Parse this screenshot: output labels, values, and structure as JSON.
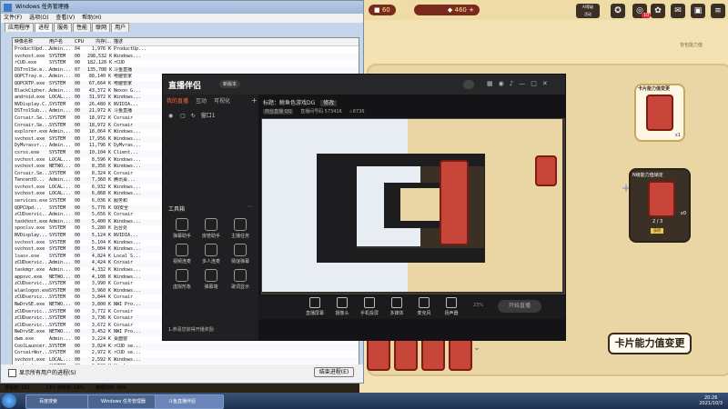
{
  "game": {
    "resources": [
      {
        "icon": "ticket-icon",
        "count": "60"
      },
      {
        "icon": "gem-icon",
        "count": "460"
      }
    ],
    "top_icons": [
      "gift-icon",
      "mail-icon",
      "settings-icon",
      "map-icon",
      "menu-icon"
    ],
    "top_icon_labels": {
      "g1": "A/等级",
      "g2": "活动"
    },
    "notification_count": "10",
    "panel_title": "卡片能力值变更",
    "card_label_top": "卡片能力值变更",
    "card_label_mid": "N级能力值锁定",
    "card_count_top": "x1",
    "card_count_mid": "x0",
    "card_pages": "2 / 3",
    "card_tag": "获得",
    "action_button": "卡片能力值变更",
    "subtitle": "背包能力值"
  },
  "taskmgr": {
    "title": "Windows 任务管理器",
    "menu": [
      "文件(F)",
      "选项(O)",
      "查看(V)",
      "帮助(H)"
    ],
    "tabs": [
      "应用程序",
      "进程",
      "服务",
      "性能",
      "联网",
      "用户"
    ],
    "columns": [
      "映像名称",
      "用户名",
      "CPU",
      "内存(...",
      "描述"
    ],
    "rows": [
      [
        "ProductUpd...",
        "Admin...",
        "04",
        "1,976 K",
        "ProductUp..."
      ],
      [
        "svchost.exe",
        "SYSTEM",
        "00",
        "298,532 K",
        "Windows..."
      ],
      [
        "rCUD.exe",
        "SYSTEM",
        "00",
        "182,128 K",
        "rCUD"
      ],
      [
        "DSTrolSe.e...",
        "Admin...",
        "07",
        "135,708 K",
        "斗鱼直播"
      ],
      [
        "QQPCTray.e...",
        "Admin...",
        "00",
        "88,140 K",
        "电脑管家"
      ],
      [
        "QQPCRTP.exe",
        "SYSTEM",
        "00",
        "67,664 K",
        "电脑管家"
      ],
      [
        "BlackCipher...",
        "Admin...",
        "00",
        "43,372 K",
        "Nexon G..."
      ],
      [
        "android.exe",
        "LOCAL...",
        "00",
        "31,972 K",
        "Windows..."
      ],
      [
        "NVDisplay.C...",
        "SYSTEM",
        "00",
        "26,480 K",
        "NVIDIA..."
      ],
      [
        "DSTrolSub...",
        "Admin...",
        "00",
        "21,972 K",
        "斗鱼直播"
      ],
      [
        "Corsair.Se...",
        "SYSTEM",
        "00",
        "18,972 K",
        "Corsair"
      ],
      [
        "Corsair.Se...",
        "SYSTEM",
        "00",
        "18,972 K",
        "Corsair"
      ],
      [
        "explorer.exe",
        "Admin...",
        "00",
        "18,064 K",
        "Windows..."
      ],
      [
        "svchost.exe",
        "SYSTEM",
        "00",
        "17,956 K",
        "Windows..."
      ],
      [
        "DyMvrasvr...",
        "Admin...",
        "00",
        "11,796 K",
        "DyMvras..."
      ],
      [
        "csrss.exe",
        "SYSTEM",
        "00",
        "10,104 K",
        "Client..."
      ],
      [
        "svchost.exe",
        "LOCAL...",
        "00",
        "8,596 K",
        "Windows..."
      ],
      [
        "svchost.exe",
        "NETWO...",
        "00",
        "8,356 K",
        "Windows..."
      ],
      [
        "Corsair.Se...",
        "SYSTEM",
        "00",
        "8,324 K",
        "Corsair"
      ],
      [
        "TencentD...",
        "Admin...",
        "00",
        "7,360 K",
        "腾讯桌..."
      ],
      [
        "svchost.exe",
        "LOCAL...",
        "00",
        "6,932 K",
        "Windows..."
      ],
      [
        "svchost.exe",
        "LOCAL...",
        "00",
        "6,868 K",
        "Windows..."
      ],
      [
        "services.exe",
        "SYSTEM",
        "00",
        "6,036 K",
        "服务和"
      ],
      [
        "QQPCUpd...",
        "SYSTEM",
        "00",
        "5,776 K",
        "QQ安全"
      ],
      [
        "zCUDservic...",
        "Admin...",
        "00",
        "5,656 K",
        "Corsair"
      ],
      [
        "taskhost.exe",
        "Admin...",
        "00",
        "5,400 K",
        "Windows..."
      ],
      [
        "spoolsv.exe",
        "SYSTEM",
        "00",
        "5,280 K",
        "后台处"
      ],
      [
        "NVDisplay...",
        "SYSTEM",
        "00",
        "5,124 K",
        "NVIDIA..."
      ],
      [
        "svchost.exe",
        "SYSTEM",
        "00",
        "5,104 K",
        "Windows..."
      ],
      [
        "svchost.exe",
        "SYSTEM",
        "00",
        "5,004 K",
        "Windows..."
      ],
      [
        "lsass.exe",
        "SYSTEM",
        "00",
        "4,824 K",
        "Local S..."
      ],
      [
        "zCUDservic...",
        "Admin...",
        "00",
        "4,424 K",
        "Corsair"
      ],
      [
        "taskmgr.exe",
        "Admin...",
        "00",
        "4,332 K",
        "Windows..."
      ],
      [
        "appsvc.exe",
        "NETWO...",
        "00",
        "4,108 K",
        "Windows..."
      ],
      [
        "zCUDservic...",
        "SYSTEM",
        "00",
        "3,990 K",
        "Corsair"
      ],
      [
        "wlanlogon.exe",
        "SYSTEM",
        "00",
        "3,960 K",
        "Windows..."
      ],
      [
        "zCUDservic...",
        "SYSTEM",
        "00",
        "3,844 K",
        "Corsair"
      ],
      [
        "NwDrvSE.exe",
        "NETWO...",
        "00",
        "3,800 K",
        "NWI Pro..."
      ],
      [
        "zCUDservic...",
        "SYSTEM",
        "00",
        "3,772 K",
        "Corsair"
      ],
      [
        "zCUDservic...",
        "SYSTEM",
        "00",
        "3,736 K",
        "Corsair"
      ],
      [
        "zCUDservic...",
        "SYSTEM",
        "00",
        "3,672 K",
        "Corsair"
      ],
      [
        "NwDrvSE.exe",
        "NETWO...",
        "00",
        "3,452 K",
        "NWI Pro..."
      ],
      [
        "dwm.exe",
        "Admin...",
        "00",
        "3,224 K",
        "桌面窗"
      ],
      [
        "CoolLauncer...",
        "SYSTEM",
        "00",
        "3,024 K",
        "rCUD se..."
      ],
      [
        "CorsairWor...",
        "SYSTEM",
        "00",
        "2,972 K",
        "rCUD se..."
      ],
      [
        "svchost.exe",
        "LOCAL...",
        "00",
        "2,592 K",
        "Windows..."
      ],
      [
        "svchost.exe",
        "SYSTEM",
        "00",
        "2,500 K",
        "Windows..."
      ],
      [
        "lsm.exe",
        "SYSTEM",
        "00",
        "2,364 K",
        "本地会话"
      ],
      [
        "conhost.exe",
        "Admin...",
        "00",
        "2,224 K",
        "控制台"
      ],
      [
        "conhost.exe",
        "SYSTEM",
        "00",
        "2,212 K",
        "控制台"
      ],
      [
        "csrss.exe",
        "SYSTEM",
        "00",
        "2,136 K",
        "Client..."
      ],
      [
        "winmit.exe",
        "SYSTEM",
        "00",
        "2,132 K",
        "Windows..."
      ],
      [
        "svchost.exe",
        "LOCAL...",
        "00",
        "2,104 K",
        "Windows..."
      ]
    ],
    "show_all_label": "显示所有用户的进程(S)",
    "end_process": "结束进程(E)",
    "status_processes": "进程数: 102",
    "status_cpu": "CPU 使用率: 18%",
    "status_mem": "物理内存: 30%"
  },
  "app": {
    "logo": "直播伴侣",
    "version_badge": "新版本",
    "nav_tabs": [
      "我的直播",
      "互动",
      "可视化"
    ],
    "stream_title_label": "标题：",
    "stream_title": "鲸鱼色游戏DG",
    "edit_label": "修改",
    "category_label": "商业直播 QQ",
    "room_id": "直播间号码 573416",
    "heat": "6736",
    "window_count": "窗口1",
    "tools_title": "工具箱",
    "tools": [
      "弹幕助手",
      "房管助手",
      "主播任务",
      "视频连麦",
      "多人连麦",
      "猜谜弹幕",
      "虚拟形象",
      "弹幕墙",
      "歌词显示"
    ],
    "footer_text": "1.恭喜您获得开播奖励",
    "bottom_controls": [
      "直播屏幕",
      "摄像头",
      "手机投屏",
      "多媒体",
      "麦克风",
      "扬声器"
    ],
    "live_button": "开始直播",
    "volume": "23%"
  },
  "taskbar": {
    "items": [
      "百度搜索",
      "Windows 任务管理器",
      "斗鱼直播伴侣"
    ],
    "time": "20:26",
    "date": "2021/10/3"
  }
}
